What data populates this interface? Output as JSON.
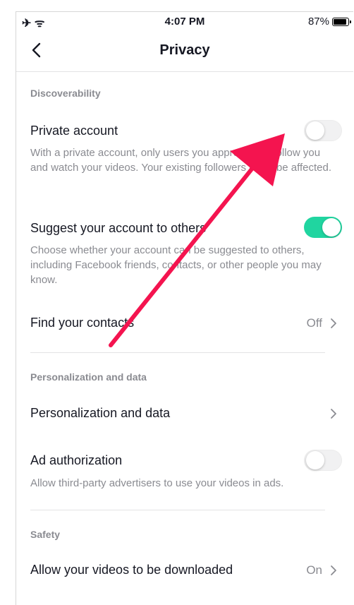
{
  "status_bar": {
    "icons_left": "✈ ᯤ",
    "time": "4:07 PM",
    "battery": "87%"
  },
  "nav": {
    "title": "Privacy"
  },
  "discoverability": {
    "header": "Discoverability",
    "private_account": {
      "title": "Private account",
      "description": "With a private account, only users you approve can follow you and watch your videos. Your existing followers won't be affected.",
      "enabled": false
    },
    "suggest_account": {
      "title": "Suggest your account to others",
      "description": "Choose whether your account can be suggested to others, including Facebook friends, contacts, or other people you may know.",
      "enabled": true
    },
    "find_contacts": {
      "title": "Find your contacts",
      "value": "Off"
    }
  },
  "personalization": {
    "header": "Personalization and data",
    "personalization_row": {
      "title": "Personalization and data"
    },
    "ad_authorization": {
      "title": "Ad authorization",
      "description": "Allow third-party advertisers to use your videos in ads.",
      "enabled": false
    }
  },
  "safety": {
    "header": "Safety",
    "downloads": {
      "title": "Allow your videos to be downloaded",
      "value": "On"
    }
  },
  "colors": {
    "toggle_on": "#20d5a0",
    "annotation_arrow": "#f4144f",
    "secondary_text": "#8a8b91"
  }
}
